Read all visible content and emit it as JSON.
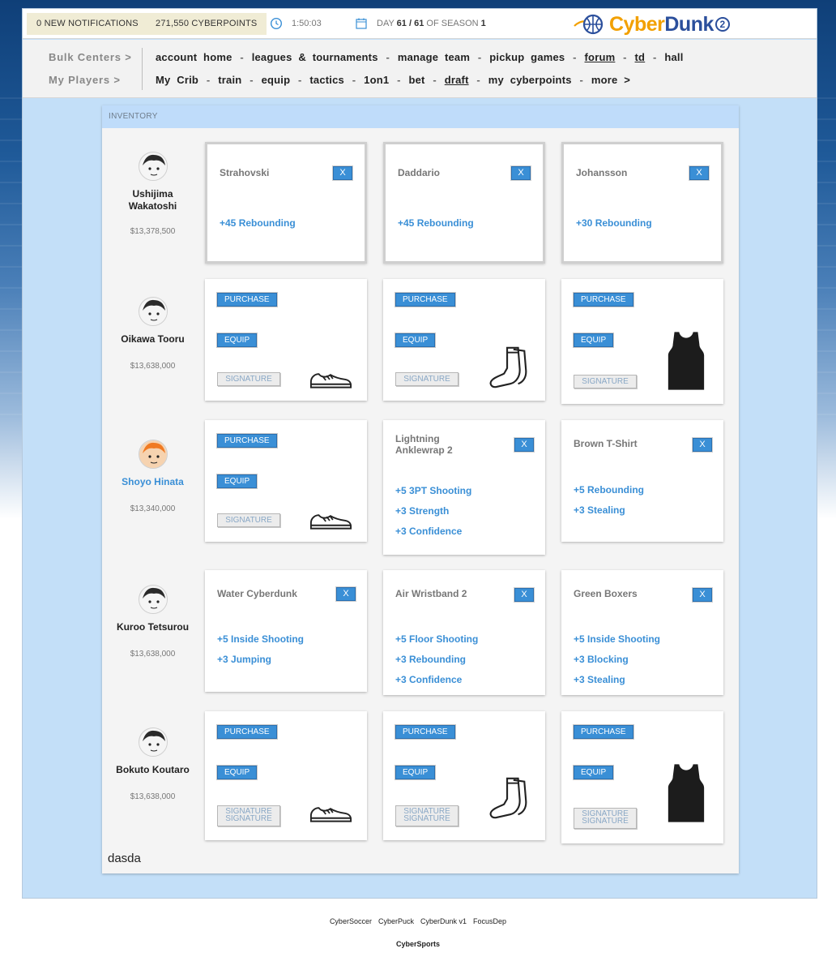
{
  "topbar": {
    "notifications": "0 NEW NOTIFICATIONS",
    "cyberpoints": "271,550 CYBERPOINTS",
    "timer": "1:50:03",
    "day_prefix": "DAY",
    "day_current": "61",
    "day_sep": "/",
    "day_total": "61",
    "season_prefix": "OF SEASON",
    "season": "1",
    "logo_part1": "Cyber",
    "logo_part2": "Dunk",
    "logo_num": "2"
  },
  "nav": {
    "row1_label": "Bulk Centers >",
    "row2_label": "My Players >",
    "row1_links": [
      "account home",
      "leagues & tournaments",
      "manage team",
      "pickup games",
      "forum",
      "td",
      "hall"
    ],
    "row2_links": [
      "My Crib",
      "train",
      "equip",
      "tactics",
      "1on1",
      "bet",
      "draft",
      "my cyberpoints",
      "more >"
    ]
  },
  "panel": {
    "heading": "INVENTORY",
    "footer_text": "dasda"
  },
  "players": [
    {
      "name": "Ushijima Wakatoshi",
      "money": "$13,378,500",
      "cards": [
        {
          "type": "item",
          "title": "Strahovski",
          "x": "X",
          "stats": [
            "+45 Rebounding"
          ]
        },
        {
          "type": "item",
          "title": "Daddario",
          "x": "X",
          "stats": [
            "+45 Rebounding"
          ]
        },
        {
          "type": "item",
          "title": "Johansson",
          "x": "X",
          "stats": [
            "+30 Rebounding"
          ]
        }
      ]
    },
    {
      "name": "Oikawa Tooru",
      "money": "$13,638,000",
      "cards": [
        {
          "type": "shop",
          "icon": "shoe-icon",
          "purchase": "PURCHASE",
          "equip": "EQUIP",
          "signature": "SIGNATURE"
        },
        {
          "type": "shop",
          "icon": "sock-icon",
          "purchase": "PURCHASE",
          "equip": "EQUIP",
          "signature": "SIGNATURE"
        },
        {
          "type": "shop",
          "icon": "jersey-icon",
          "purchase": "PURCHASE",
          "equip": "EQUIP",
          "signature": "SIGNATURE"
        }
      ]
    },
    {
      "name": "Shoyo Hinata",
      "money": "$13,340,000",
      "cards": [
        {
          "type": "shop",
          "icon": "shoe-icon",
          "purchase": "PURCHASE",
          "equip": "EQUIP",
          "signature": "SIGNATURE"
        },
        {
          "type": "item",
          "title": "Lightning Anklewrap 2",
          "x": "X",
          "stats": [
            "+5 3PT Shooting",
            "+3 Strength",
            "+3 Confidence"
          ]
        },
        {
          "type": "item",
          "title": "Brown T-Shirt",
          "x": "X",
          "stats": [
            "+5 Rebounding",
            "+3 Stealing"
          ]
        }
      ]
    },
    {
      "name": "Kuroo Tetsurou",
      "money": "$13,638,000",
      "cards": [
        {
          "type": "item",
          "title": "Water Cyberdunk",
          "x": "X",
          "stats": [
            "+5 Inside Shooting",
            "+3 Jumping"
          ]
        },
        {
          "type": "item",
          "title": "Air Wristband 2",
          "x": "X",
          "stats": [
            "+5 Floor Shooting",
            "+3 Rebounding",
            "+3 Confidence"
          ]
        },
        {
          "type": "item",
          "title": "Green Boxers",
          "x": "X",
          "stats": [
            "+5 Inside Shooting",
            "+3 Blocking",
            "+3 Stealing"
          ]
        }
      ]
    },
    {
      "name": "Bokuto Koutaro",
      "money": "$13,638,000",
      "cards": [
        {
          "type": "shop",
          "icon": "shoe-icon",
          "purchase": "PURCHASE",
          "equip": "EQUIP",
          "signature": "SIGNATURE",
          "signature2": "SIGNATURE"
        },
        {
          "type": "shop",
          "icon": "sock-icon",
          "purchase": "PURCHASE",
          "equip": "EQUIP",
          "signature": "SIGNATURE",
          "signature2": "SIGNATURE"
        },
        {
          "type": "shop",
          "icon": "jersey-icon",
          "purchase": "PURCHASE",
          "equip": "EQUIP",
          "signature": "SIGNATURE",
          "signature2": "SIGNATURE"
        }
      ]
    }
  ],
  "footer": {
    "links": [
      "CyberSoccer",
      "CyberPuck",
      "CyberDunk v1",
      "FocusDep"
    ],
    "brand": "CyberSports"
  }
}
